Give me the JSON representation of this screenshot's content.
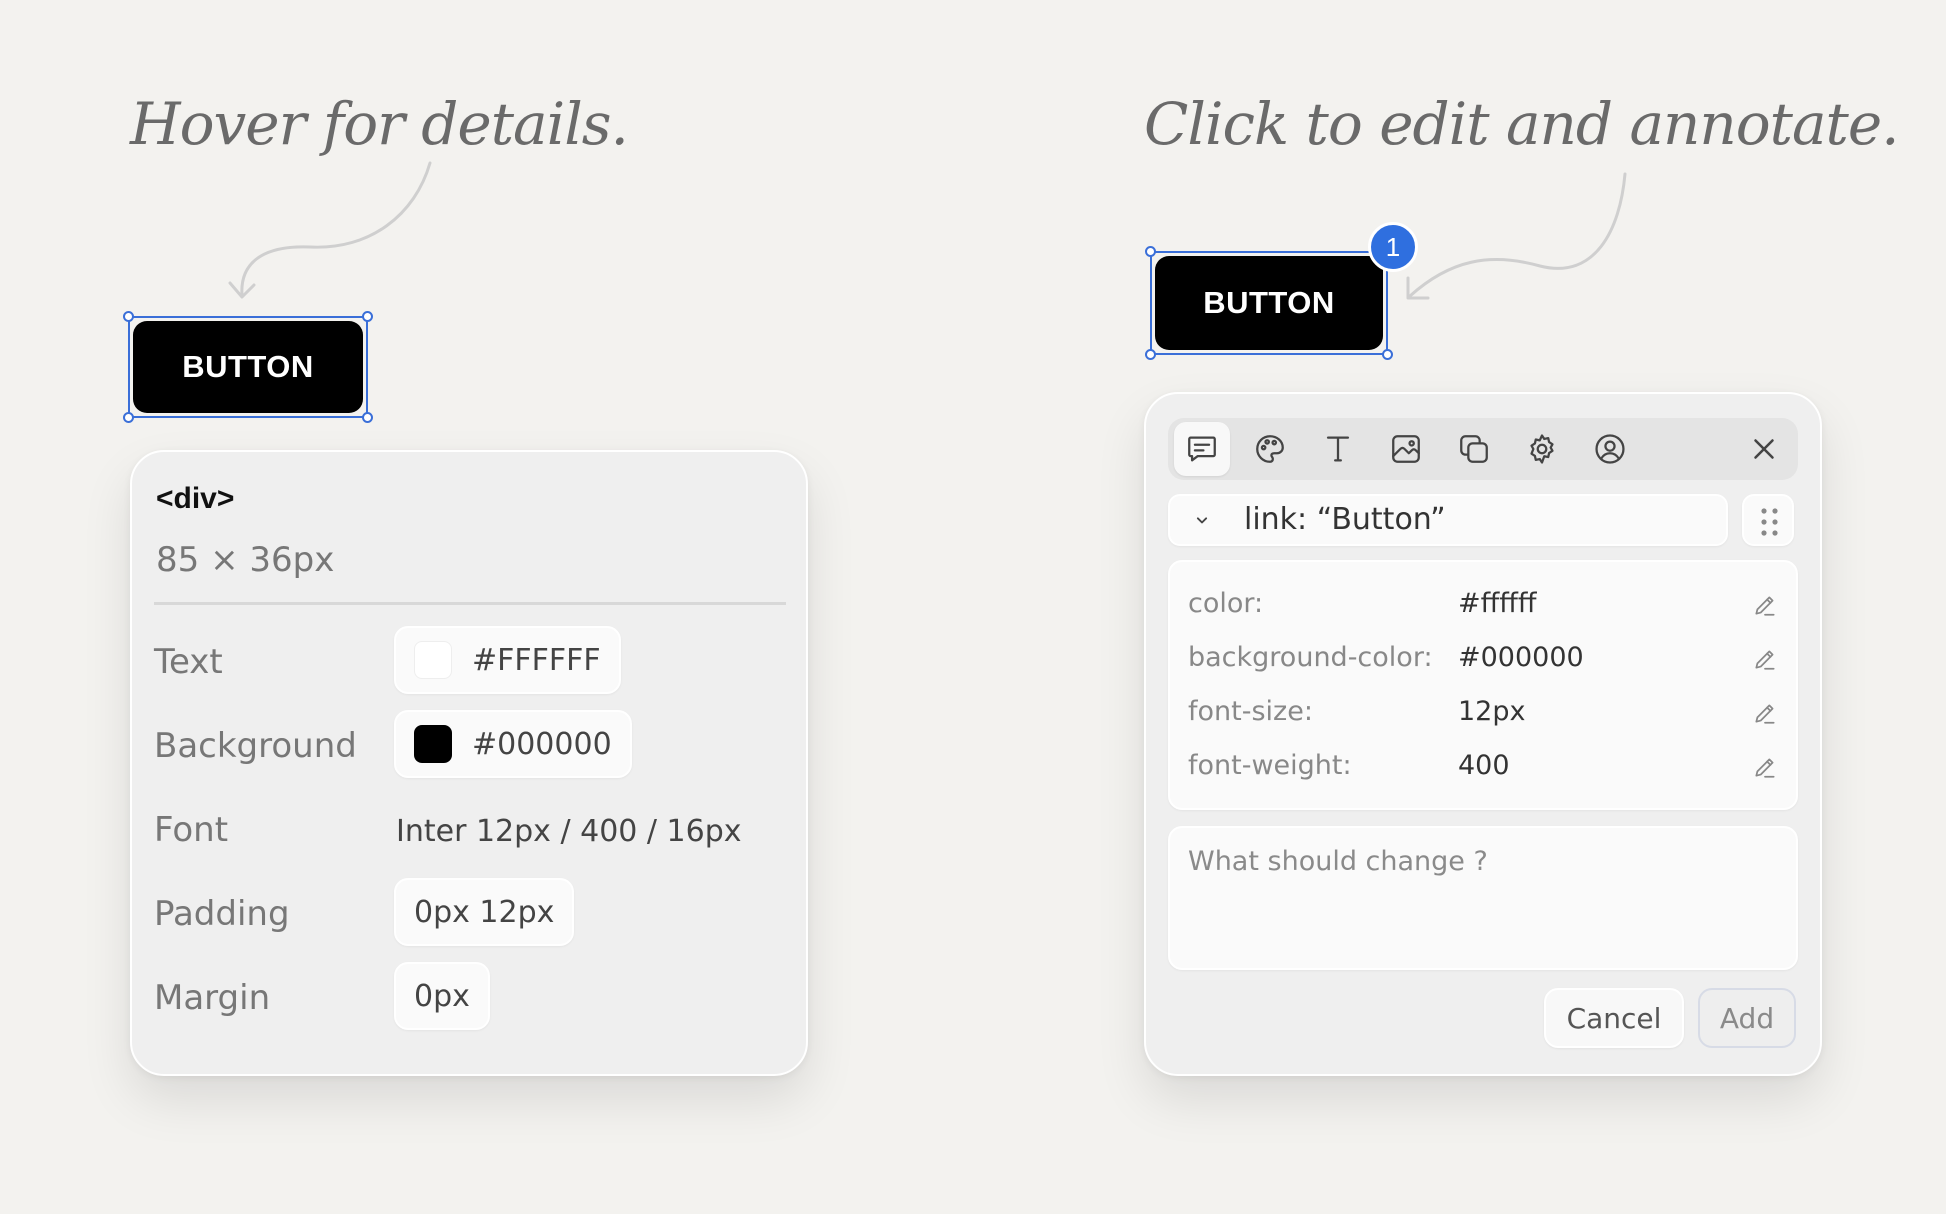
{
  "left_demo": {
    "caption": "Hover for details.",
    "button_label": "BUTTON",
    "inspector": {
      "tag": "<div>",
      "size": "85 × 36px",
      "text_label": "Text",
      "text_color": "#FFFFFF",
      "background_label": "Background",
      "background_color": "#000000",
      "font_label": "Font",
      "font_value": "Inter 12px / 400 / 16px",
      "padding_label": "Padding",
      "padding_value": "0px 12px",
      "margin_label": "Margin",
      "margin_value": "0px"
    }
  },
  "right_demo": {
    "caption": "Click to edit and annotate.",
    "button_label": "BUTTON",
    "badge_count": "1",
    "toolbar": {
      "tools": [
        "comment-icon",
        "palette-icon",
        "text-icon",
        "image-icon",
        "layers-icon",
        "settings-icon",
        "user-icon"
      ],
      "close_icon": "close-icon"
    },
    "selector_text": "link: “Button”",
    "properties": [
      {
        "name": "color:",
        "value": "#ffffff"
      },
      {
        "name": "background-color:",
        "value": "#000000"
      },
      {
        "name": "font-size:",
        "value": "12px"
      },
      {
        "name": "font-weight:",
        "value": "400"
      }
    ],
    "note_placeholder": "What should change ?",
    "cancel_label": "Cancel",
    "add_label": "Add"
  },
  "colors": {
    "background": "#f3f2ef",
    "selection": "#3a6fd8",
    "badge": "#2f6fdf",
    "button": "#000000"
  }
}
